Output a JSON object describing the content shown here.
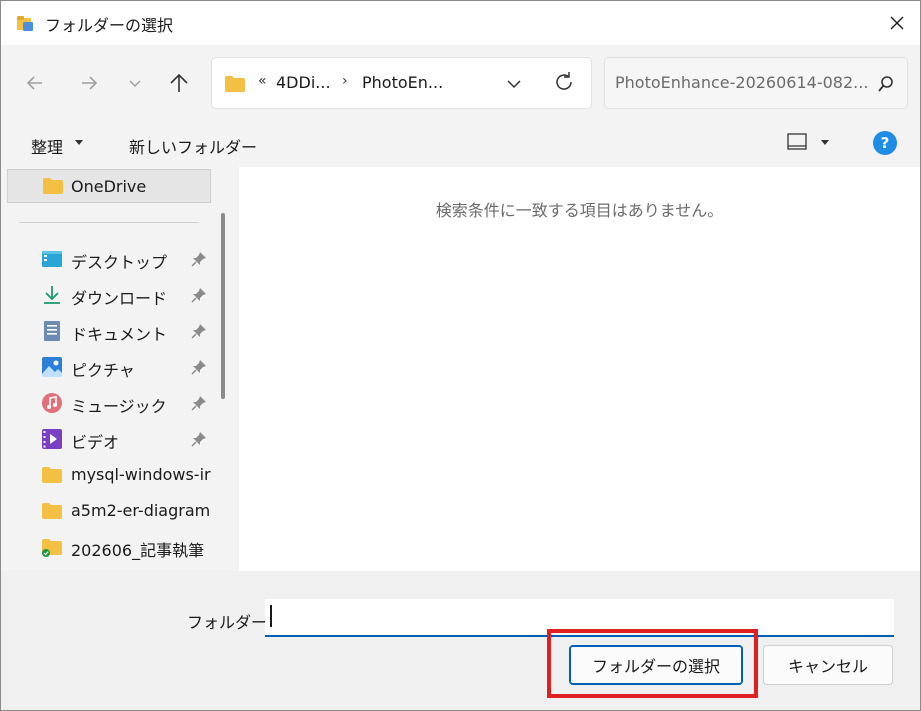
{
  "window": {
    "title": "フォルダーの選択"
  },
  "nav": {
    "breadcrumb": [
      "4DDi...",
      "PhotoEn..."
    ],
    "breadcrumb_overflow": "«",
    "search_placeholder": "PhotoEnhance-20260614-082..."
  },
  "toolbar": {
    "organize_label": "整理",
    "new_folder_label": "新しいフォルダー",
    "help_label": "?"
  },
  "sidebar": {
    "selected": {
      "label": "OneDrive",
      "icon": "folder-icon"
    },
    "items": [
      {
        "label": "デスクトップ",
        "icon": "desktop-icon",
        "pinned": true
      },
      {
        "label": "ダウンロード",
        "icon": "download-icon",
        "pinned": true
      },
      {
        "label": "ドキュメント",
        "icon": "document-icon",
        "pinned": true
      },
      {
        "label": "ピクチャ",
        "icon": "pictures-icon",
        "pinned": true
      },
      {
        "label": "ミュージック",
        "icon": "music-icon",
        "pinned": true
      },
      {
        "label": "ビデオ",
        "icon": "video-icon",
        "pinned": true
      },
      {
        "label": "mysql-windows-ir",
        "icon": "folder-icon",
        "pinned": false
      },
      {
        "label": "a5m2-er-diagram",
        "icon": "folder-icon",
        "pinned": false
      },
      {
        "label": "202606_記事執筆",
        "icon": "folder-synced-icon",
        "pinned": false
      }
    ]
  },
  "content": {
    "empty_message": "検索条件に一致する項目はありません。"
  },
  "footer": {
    "folder_label": "フォルダー:",
    "folder_value": "",
    "select_button": "フォルダーの選択",
    "cancel_button": "キャンセル"
  },
  "colors": {
    "accent": "#005fb8",
    "highlight": "#e02020",
    "folder": "#f3c043"
  }
}
